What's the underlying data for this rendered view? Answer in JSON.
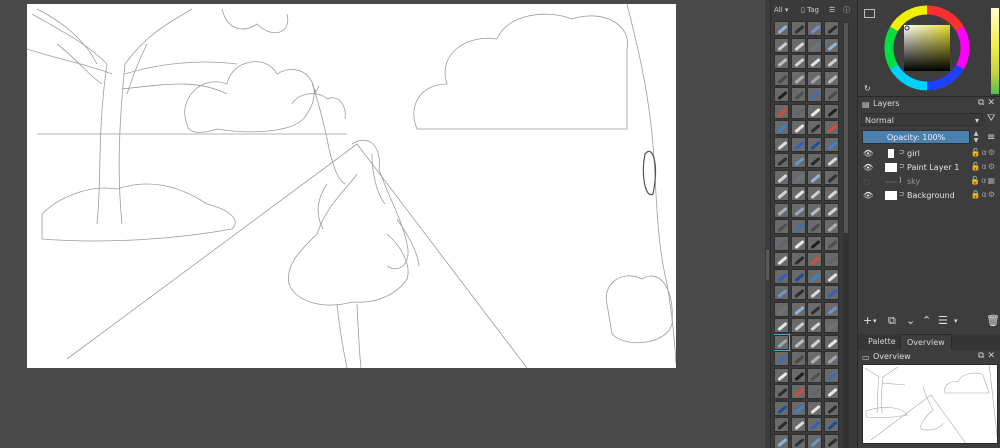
{
  "brush_docker": {
    "tag_filter": "All",
    "tag_label": "Tag",
    "brush_colors": [
      "#8fb4d9",
      "#9aa7b5",
      "#5e6470",
      "#d7dce0",
      "#c9ced3",
      "#3a6db5",
      "#e3e3e3",
      "#2f3033",
      "#b7bdc3",
      "#e9e9e9",
      "#2d5ec0",
      "#d4d7da",
      "#47494c",
      "#2a2c2e",
      "#6c94c5",
      "#cfd3d6",
      "#202020",
      "#1b4f9a",
      "#6a7581",
      "#aab0b5",
      "#d94b33",
      "#2b2b2b",
      "#e5e5e5",
      "#4e4f52",
      "#3d7fd0"
    ]
  },
  "color_selector": {
    "reset_icon": "reset-icon"
  },
  "layers": {
    "title": "Layers",
    "blend_mode": "Normal",
    "opacity_label": "Opacity:  100%",
    "items": [
      {
        "name": "girl",
        "visible": true,
        "dim": false
      },
      {
        "name": "Paint Layer 1",
        "visible": true,
        "dim": false
      },
      {
        "name": "sky",
        "visible": false,
        "dim": true
      },
      {
        "name": "Background",
        "visible": true,
        "dim": false
      }
    ],
    "tool_icons": [
      "add-layer-icon",
      "duplicate-layer-icon",
      "move-down-icon",
      "move-up-icon",
      "layer-properties-icon",
      "delete-layer-icon"
    ]
  },
  "tabs": {
    "palette": "Palette",
    "overview": "Overview"
  },
  "overview": {
    "title": "Overview"
  }
}
